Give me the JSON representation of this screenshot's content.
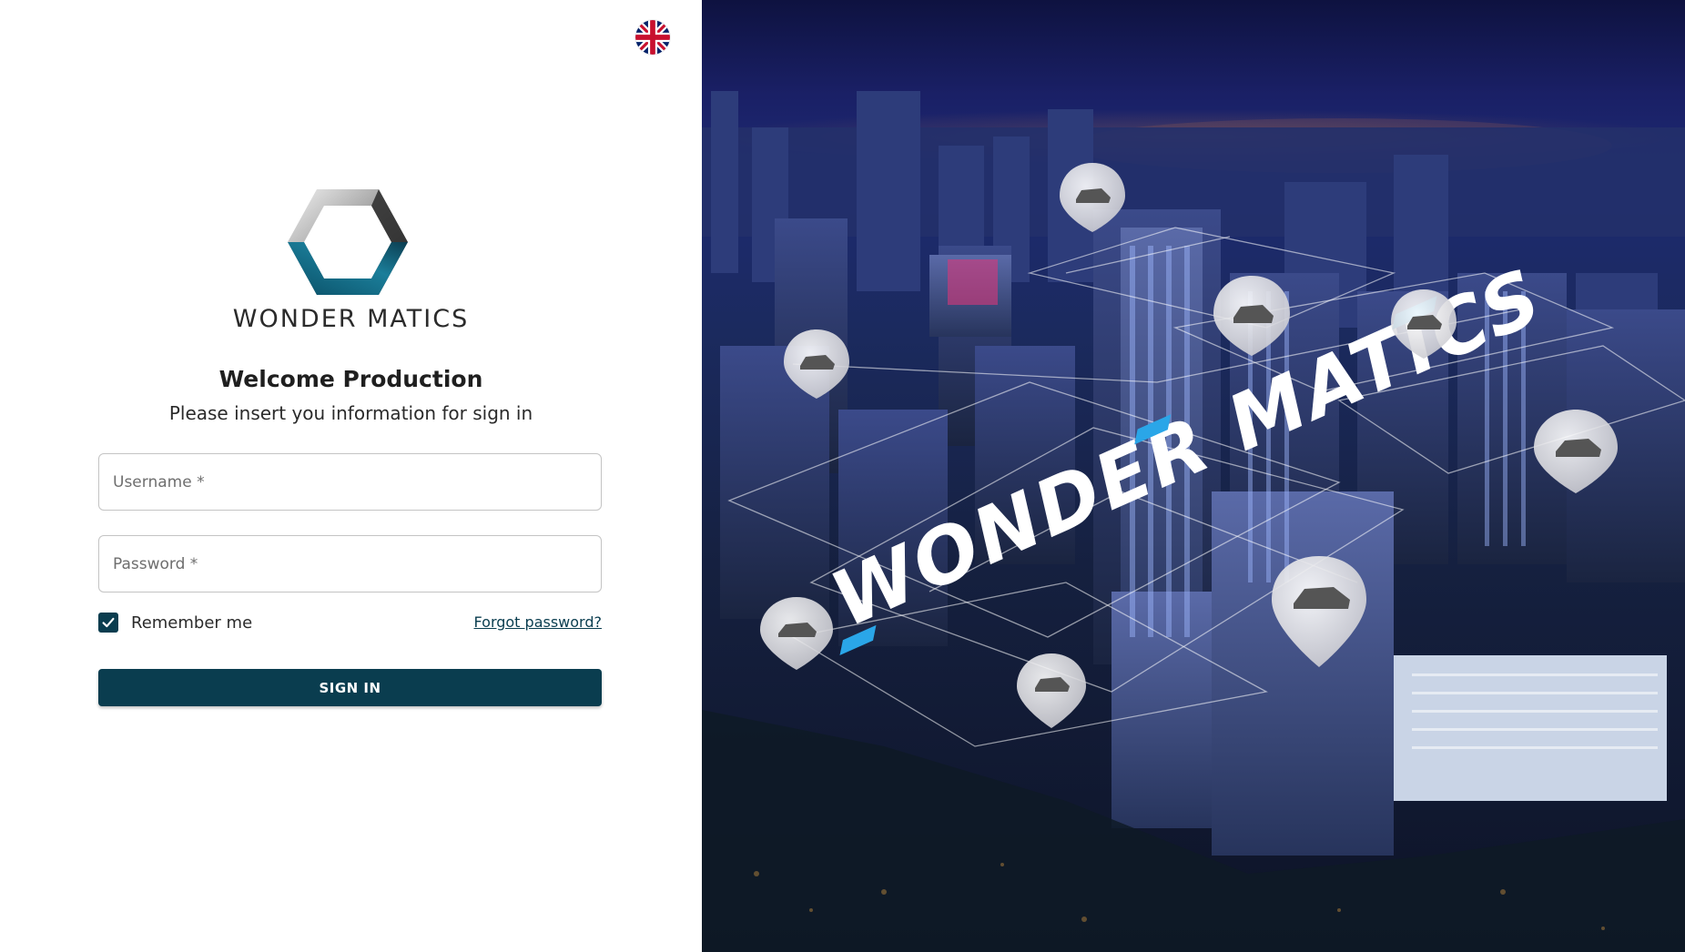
{
  "brand": {
    "name": "WONDER MATICS",
    "logo_icon": "hexagon-ring-logo-icon"
  },
  "language": {
    "icon": "uk-flag-icon",
    "current": "en"
  },
  "header": {
    "title": "Welcome Production",
    "subtitle": "Please insert you information for sign in"
  },
  "form": {
    "username_placeholder": "Username *",
    "password_placeholder": "Password *",
    "remember_label": "Remember me",
    "remember_checked": true,
    "forgot_label": "Forgot password?",
    "signin_label": "SIGN IN"
  },
  "hero": {
    "banner_text": "WONDER MATICS",
    "pin_icon": "car-location-pin-icon"
  },
  "colors": {
    "primary": "#0a3d4f",
    "accent_blue": "#2aa6e8",
    "night_sky": "#1a2066"
  }
}
